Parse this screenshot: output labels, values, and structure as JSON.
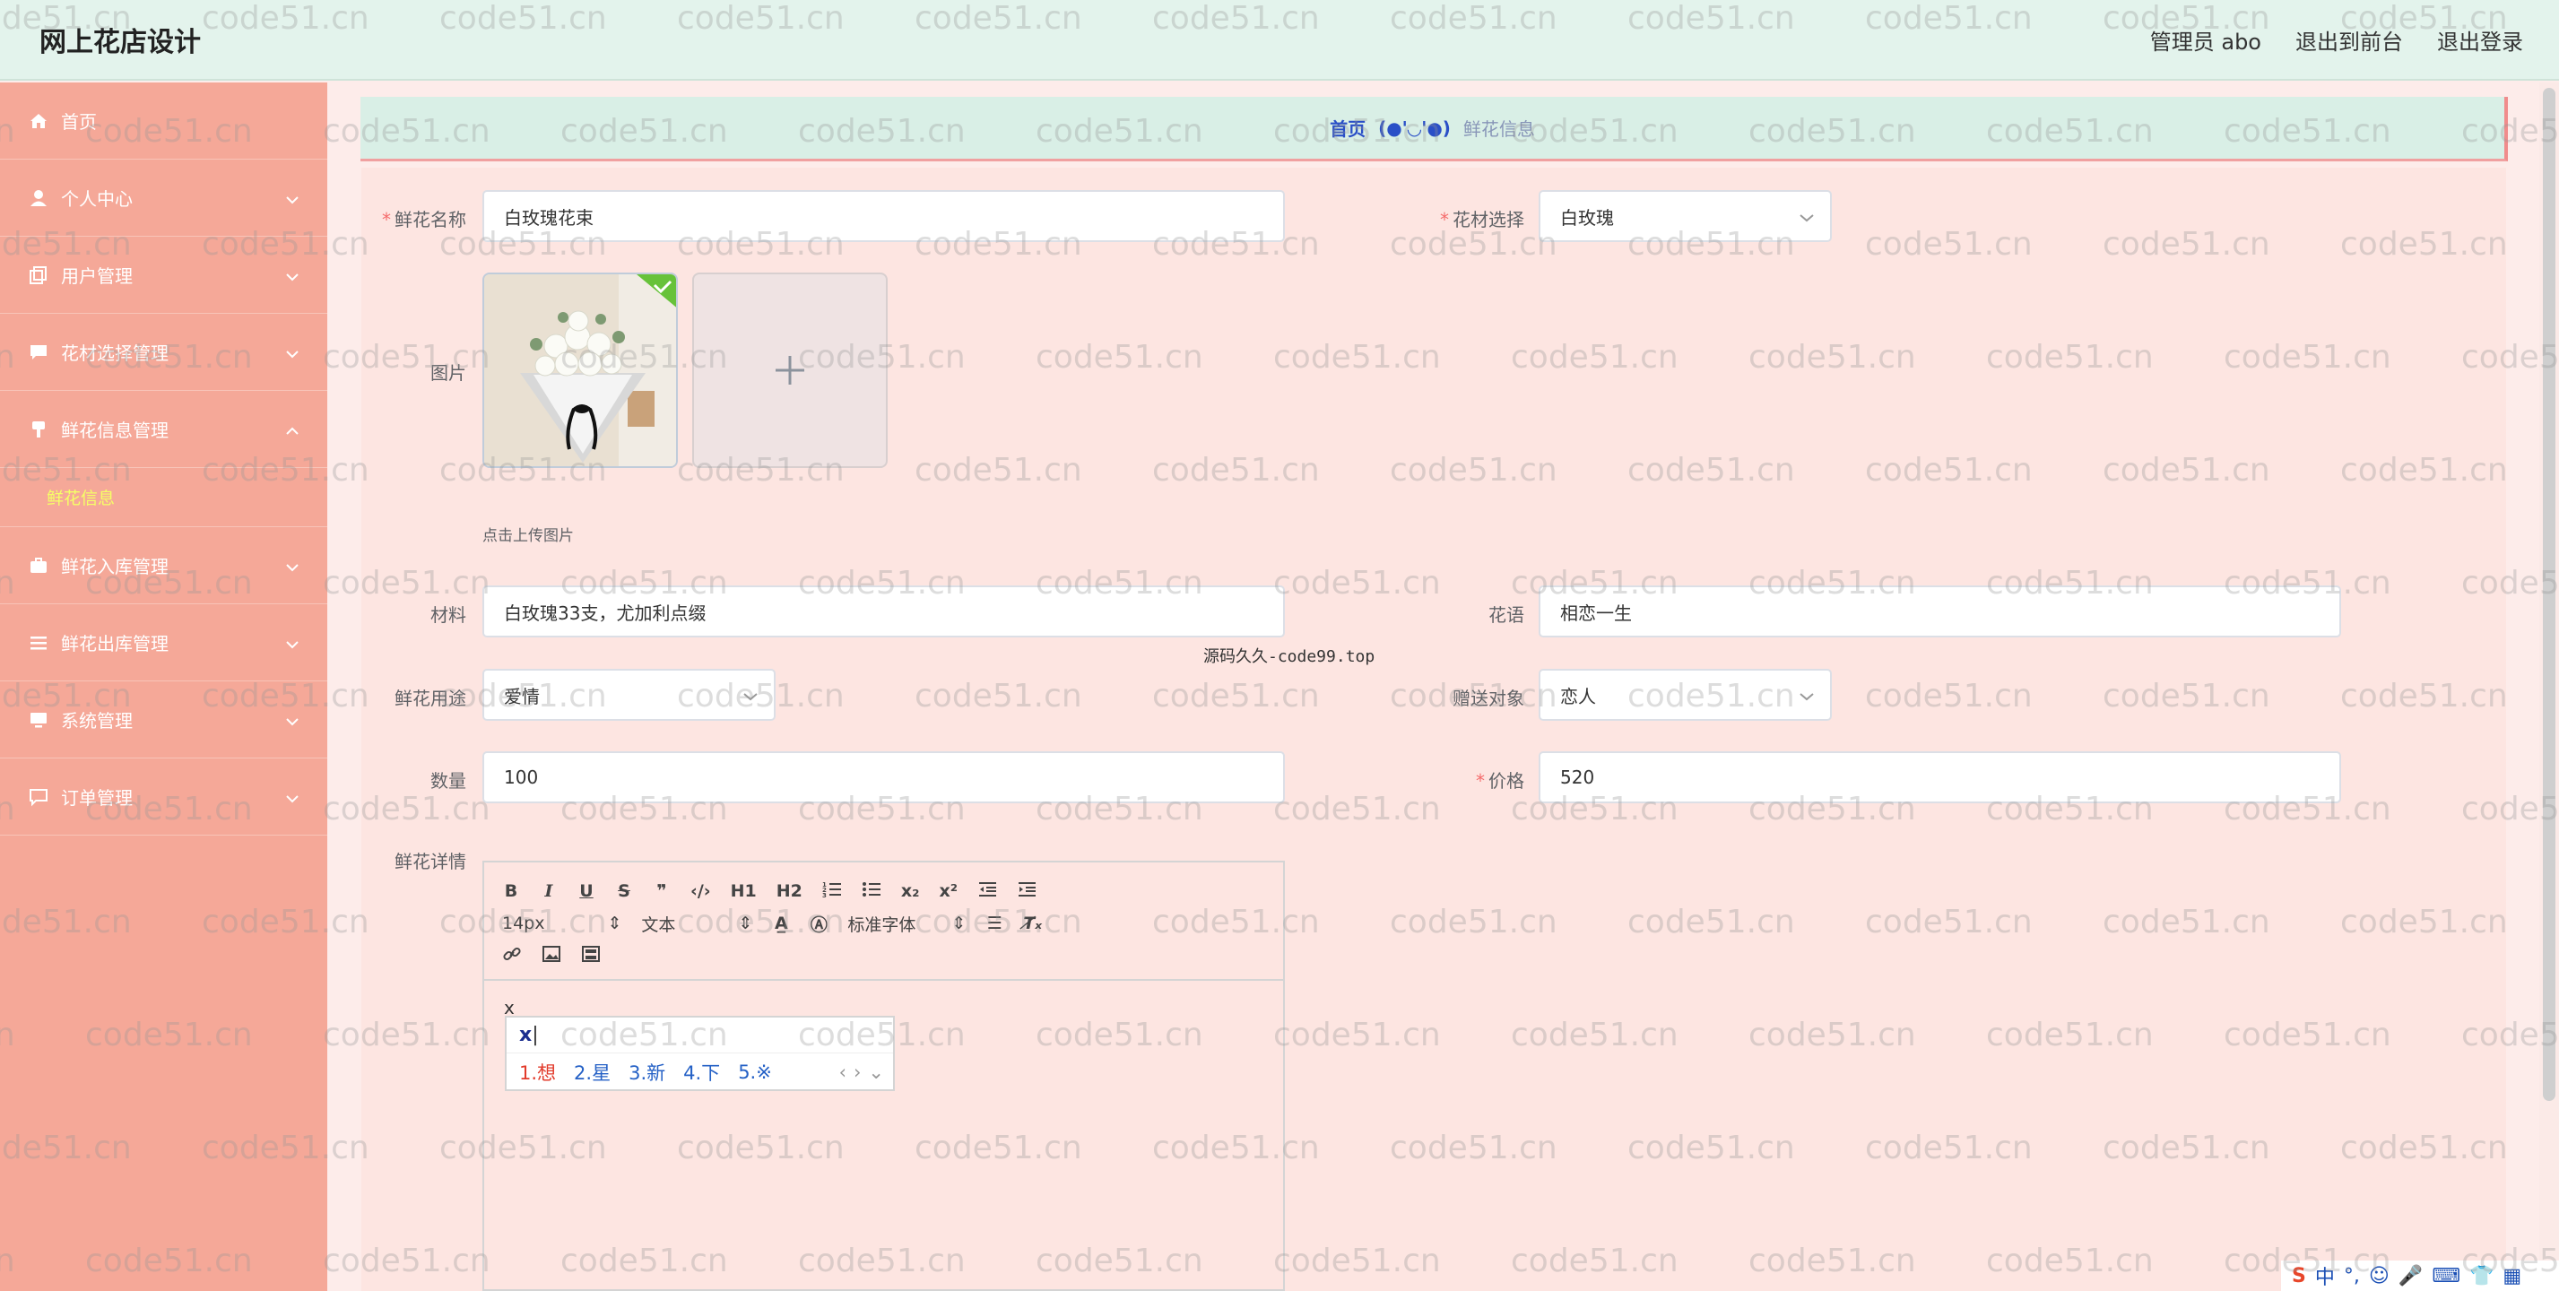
{
  "header": {
    "brand": "网上花店设计",
    "admin": "管理员 abo",
    "to_front": "退出到前台",
    "logout": "退出登录"
  },
  "sidebar": {
    "items": [
      {
        "label": "首页",
        "icon": "home-icon"
      },
      {
        "label": "个人中心",
        "icon": "user-icon"
      },
      {
        "label": "用户管理",
        "icon": "copy-icon"
      },
      {
        "label": "花材选择管理",
        "icon": "chat-icon"
      },
      {
        "label": "鲜花信息管理",
        "icon": "brush-icon",
        "expanded": true,
        "children": [
          "鲜花信息"
        ]
      },
      {
        "label": "鲜花入库管理",
        "icon": "briefcase-icon"
      },
      {
        "label": "鲜花出库管理",
        "icon": "list-icon"
      },
      {
        "label": "系统管理",
        "icon": "monitor-icon"
      },
      {
        "label": "订单管理",
        "icon": "message-icon"
      }
    ]
  },
  "breadcrumb": {
    "home": "首页",
    "face": "(●'◡'●)",
    "current": "鲜花信息"
  },
  "form": {
    "name": {
      "label": "鲜花名称",
      "value": "白玫瑰花束",
      "required": true
    },
    "material_select": {
      "label": "花材选择",
      "value": "白玫瑰",
      "required": true
    },
    "image": {
      "label": "图片",
      "tip": "点击上传图片"
    },
    "material": {
      "label": "材料",
      "value": "白玫瑰33支，尤加利点缀"
    },
    "language": {
      "label": "花语",
      "value": "相恋一生"
    },
    "usage": {
      "label": "鲜花用途",
      "value": "爱情"
    },
    "recipient": {
      "label": "赠送对象",
      "value": "恋人"
    },
    "quantity": {
      "label": "数量",
      "value": "100"
    },
    "price": {
      "label": "价格",
      "value": "520",
      "required": true
    },
    "detail": {
      "label": "鲜花详情"
    }
  },
  "note": "源码久久-code99.top",
  "editor": {
    "font_size": "14px",
    "paragraph": "文本",
    "font_family": "标准字体",
    "content": "x",
    "buttons": [
      "B",
      "I",
      "U",
      "S",
      "❞",
      "‹/›",
      "H1",
      "H2",
      "ol",
      "ul",
      "x₂",
      "x²",
      "outdent",
      "indent"
    ]
  },
  "ime": {
    "input": "x",
    "candidates": [
      "1.想",
      "2.星",
      "3.新",
      "4.下",
      "5.※"
    ]
  },
  "tray": {
    "lang": "中"
  },
  "watermark": "code51.cn",
  "colors": {
    "header_bg": "#e3f3ec",
    "sidebar_bg": "#f5a898",
    "content_bg": "#fde5e1",
    "active_submenu": "#f5ff66",
    "required": "#f56c6c"
  }
}
